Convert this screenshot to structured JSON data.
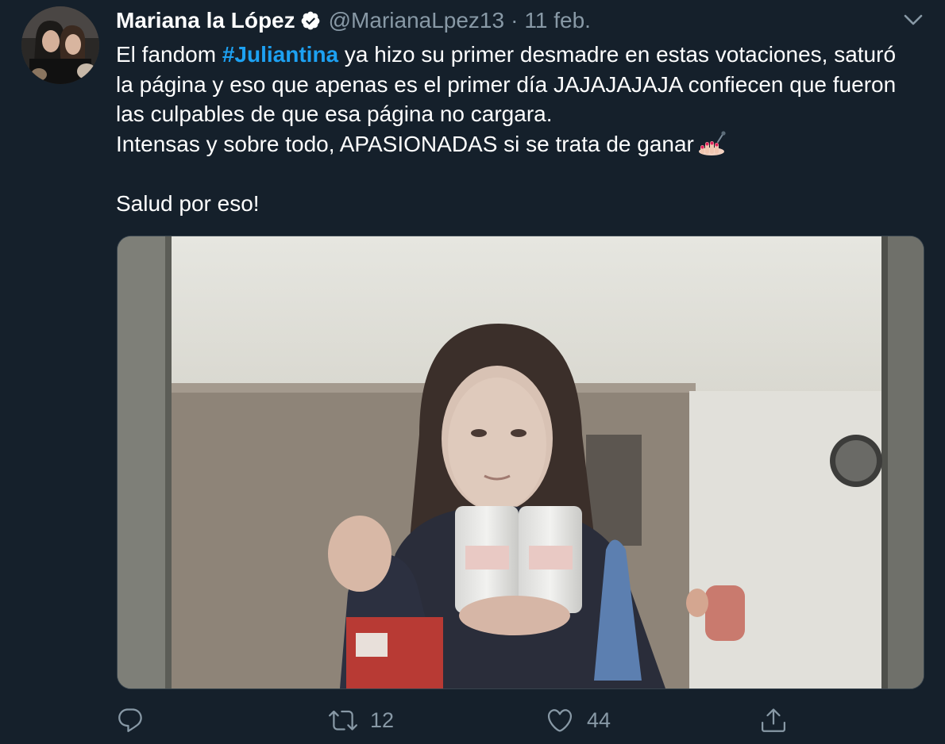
{
  "tweet": {
    "author": {
      "display_name": "Mariana la López",
      "handle": "@MarianaLpez13",
      "verified": true
    },
    "separator": "·",
    "date": "11 feb.",
    "text": {
      "line1_before": "El fandom ",
      "hashtag": "#Juliantina",
      "line1_after": " ya hizo su primer desmadre en estas votaciones, saturó",
      "line2": "la página y eso que apenas es el primer día JAJAJAJAJA confiecen que fueron",
      "line3": "las culpables de que esa página no cargara.",
      "line4": "Intensas y sobre todo, APASIONADAS si se trata de ganar",
      "line4_emoji": "nail-polish-emoji",
      "line6": "Salud por eso!"
    },
    "media": {
      "type": "photo"
    },
    "actions": {
      "reply_icon": "reply-icon",
      "retweet_icon": "retweet-icon",
      "retweet_count": "12",
      "like_icon": "heart-icon",
      "like_count": "44",
      "share_icon": "share-icon"
    },
    "colors": {
      "background": "#15202b",
      "text": "#ffffff",
      "secondary": "#8899a6",
      "link": "#1da1f2"
    }
  }
}
